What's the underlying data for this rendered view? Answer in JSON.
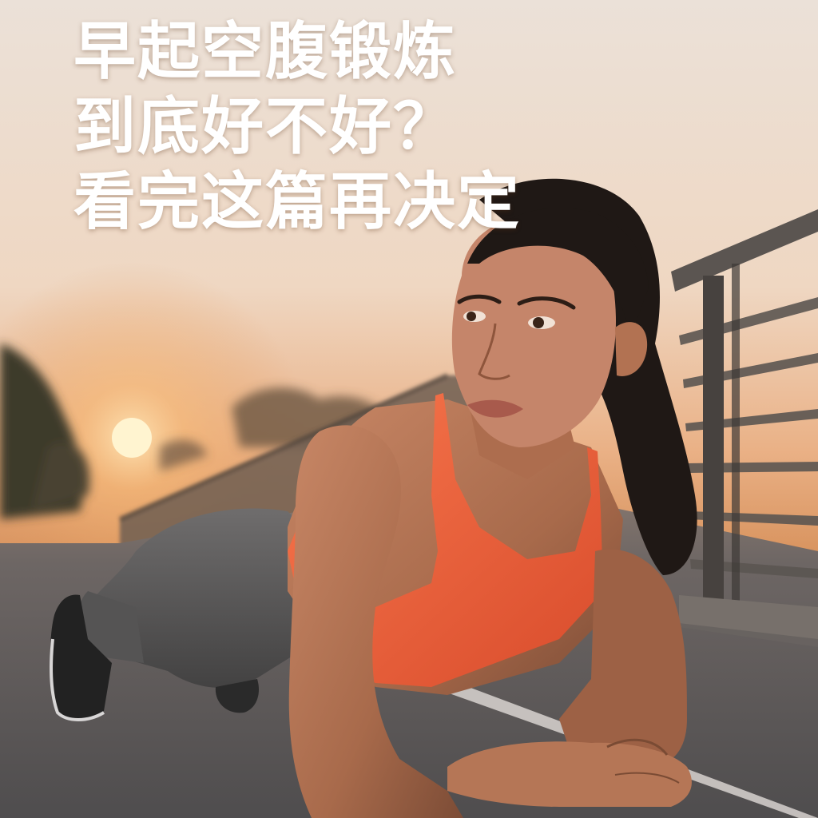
{
  "headline": {
    "lines": [
      "早起空腹锻炼",
      "到底好不好？",
      "看完这篇再决定"
    ]
  },
  "colors": {
    "sky_top": "#e9ddd3",
    "sky_glow": "#e8a86a",
    "sun": "#fff2c8",
    "ground": "#5e5c5c",
    "sports_bra": "#f2603a",
    "leggings": "#5d5d5d",
    "hair": "#1e1714",
    "skin": "#b87857",
    "railing": "#4a4744"
  },
  "icons": [
    "sun-icon"
  ]
}
